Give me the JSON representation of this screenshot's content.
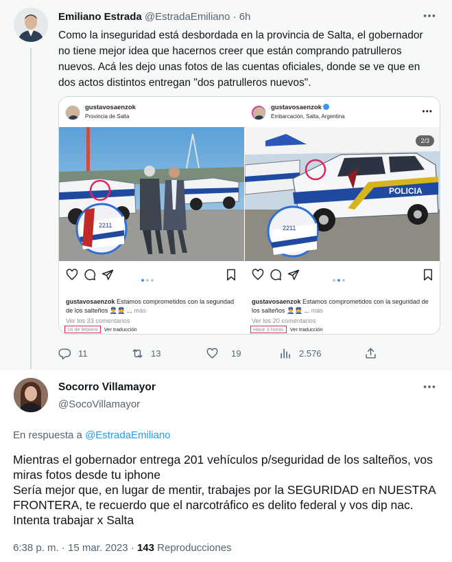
{
  "tweet1": {
    "author_name": "Emiliano Estrada",
    "handle": "@EstradaEmiliano",
    "separator": "·",
    "time": "6h",
    "text": "Como la inseguridad está desbordada en la provincia de Salta, el gobernador no tiene mejor idea que hacernos creer que están comprando patrulleros nuevos. Acá les dejo unas fotos de las cuentas oficiales, donde se ve que en dos actos distintos entregan \"dos patrulleros nuevos\".",
    "actions": {
      "replies": "11",
      "retweets": "13",
      "likes": "19",
      "views": "2.576"
    },
    "media": {
      "left": {
        "username": "gustavosaenzok",
        "location": "Provincia de Salta",
        "caption_user": "gustavosaenzok",
        "caption_text": "Estamos comprometidos con la seguridad de los salteños 👮‍♂️👮 ...",
        "caption_more": "más",
        "comments": "Ver los 33 comentarios",
        "date": "16 de febrero",
        "translate": "Ver traducción",
        "plate": "2211"
      },
      "right": {
        "username": "gustavosaenzok",
        "location": "Embarcación, Salta, Argentina",
        "page_badge": "2/3",
        "caption_user": "gustavosaenzok",
        "caption_text": "Estamos comprometidos con la seguridad de los salteños 👮‍♂️👮 ...",
        "caption_more": "más",
        "comments": "Ver los 20 comentarios",
        "date": "Hace 3 horas",
        "translate": "Ver traducción",
        "plate": "2211",
        "door_text": "POLICIA",
        "hood_text": "POLICIA"
      }
    }
  },
  "tweet2": {
    "author_name": "Socorro Villamayor",
    "handle": "@SocoVillamayor",
    "reply_prefix": "En respuesta a",
    "reply_to": "@EstradaEmiliano",
    "lines": [
      "Mientras el gobernador entrega 201 vehículos p/seguridad de los salteños, vos miras fotos desde tu iphone",
      "Sería mejor que, en lugar de mentir, trabajes por la SEGURIDAD en NUESTRA FRONTERA, te recuerdo que el narcotráfico es delito federal y vos dip nac. Intenta trabajar x Salta"
    ],
    "timestamp": "6:38 p. m. · 15 mar. 2023 ·",
    "views_count": "143",
    "views_label": "Reproducciones"
  },
  "colors": {
    "text": "#0f1419",
    "muted": "#536471",
    "link": "#1d9bf0",
    "parent_bg": "#f7f9f9",
    "highlight": "#e0245e"
  },
  "icons": [
    "more-icon",
    "reply-icon",
    "retweet-icon",
    "like-icon",
    "views-icon",
    "share-icon",
    "ig-heart-icon",
    "ig-comment-icon",
    "ig-send-icon",
    "ig-bookmark-icon"
  ]
}
